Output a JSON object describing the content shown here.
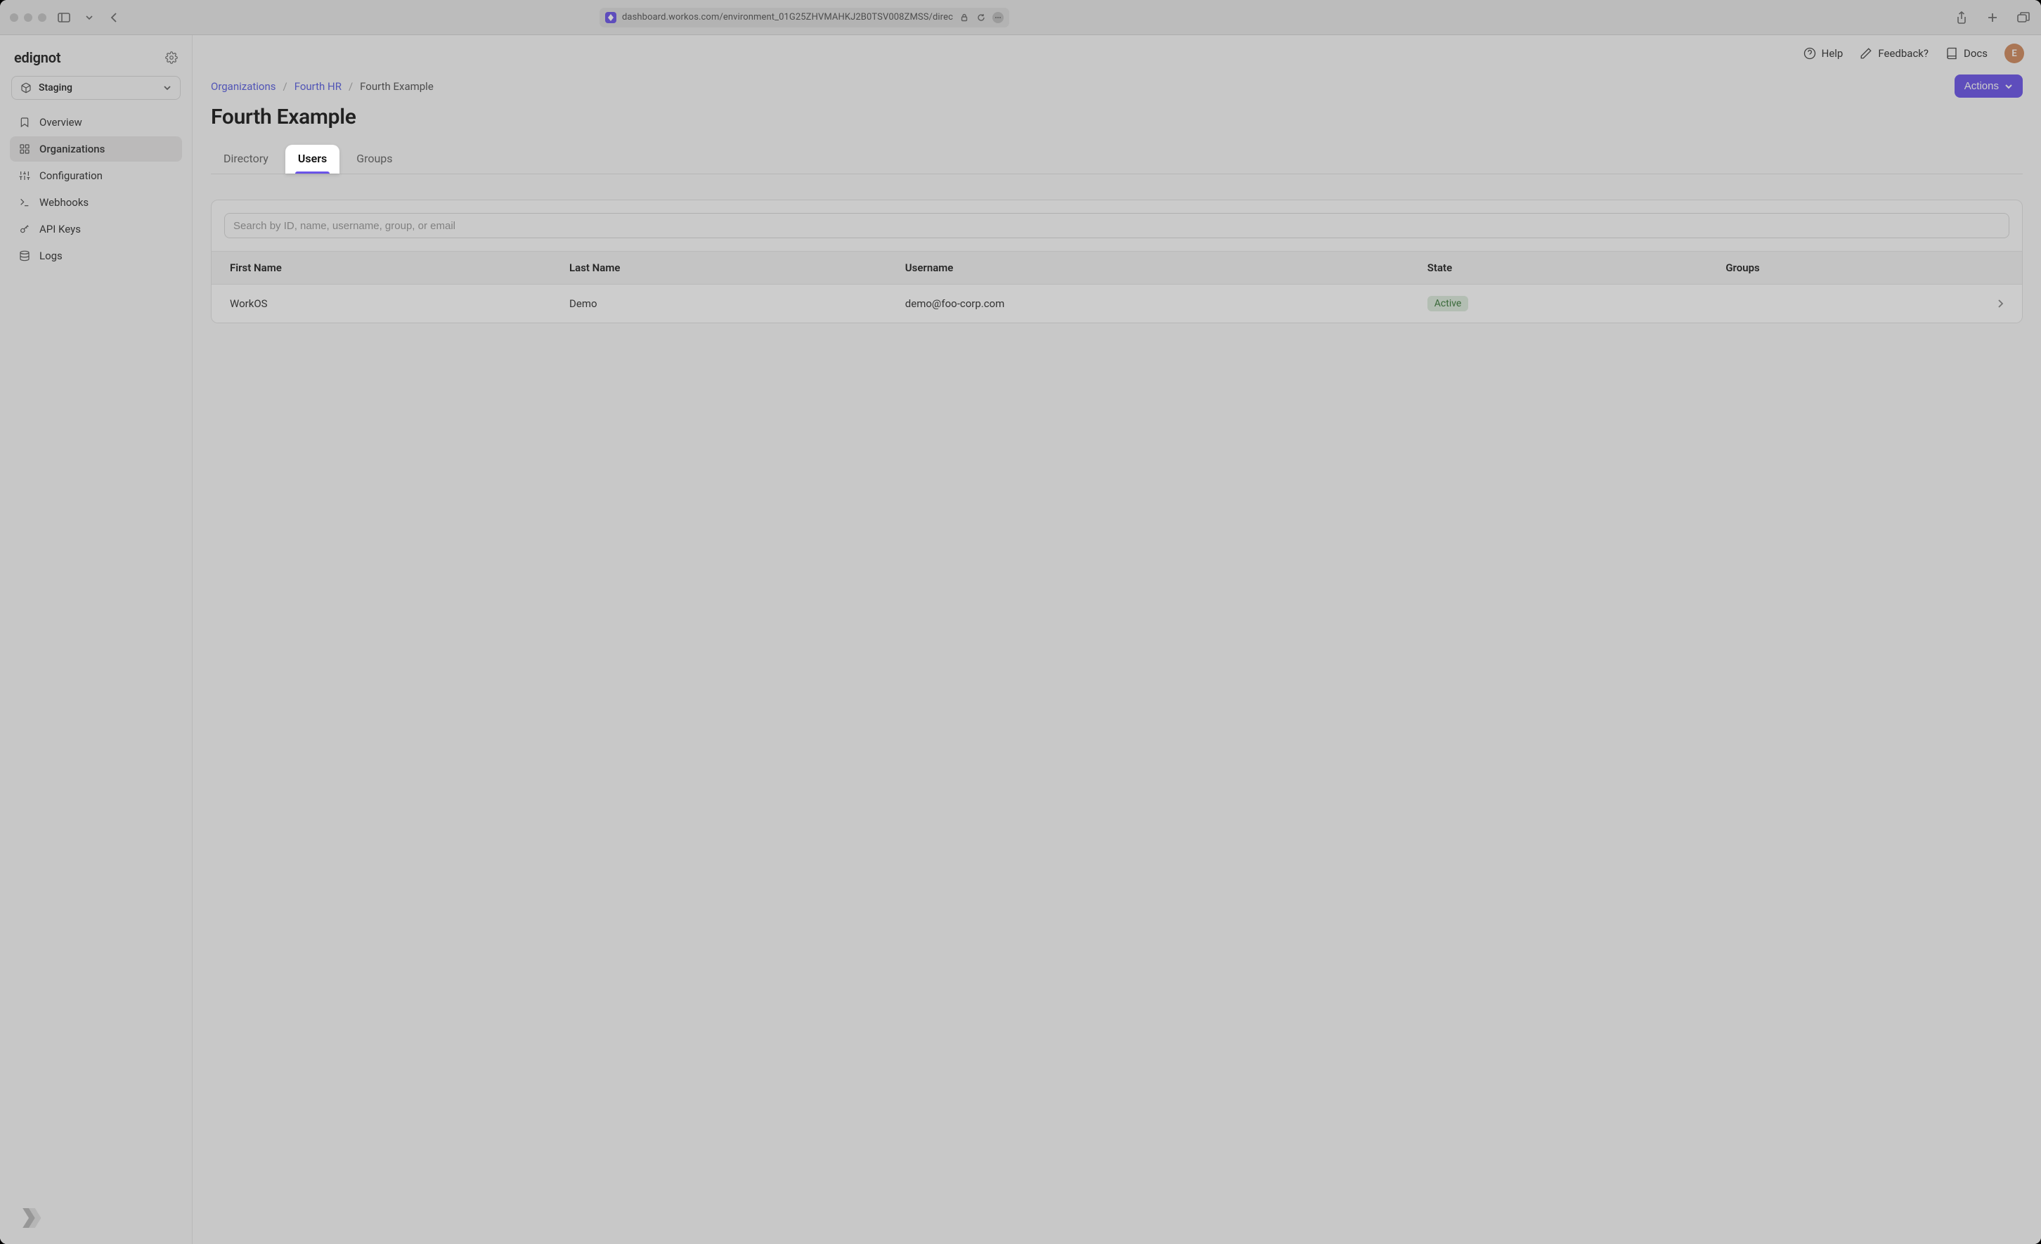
{
  "browser": {
    "url": "dashboard.workos.com/environment_01G25ZHVMAHKJ2B0TSV008ZMSS/direc"
  },
  "workspace": {
    "name": "edignot"
  },
  "environment": {
    "selected": "Staging"
  },
  "sidebar": {
    "items": [
      {
        "label": "Overview"
      },
      {
        "label": "Organizations"
      },
      {
        "label": "Configuration"
      },
      {
        "label": "Webhooks"
      },
      {
        "label": "API Keys"
      },
      {
        "label": "Logs"
      }
    ]
  },
  "topbar": {
    "help": "Help",
    "feedback": "Feedback?",
    "docs": "Docs",
    "avatar_initial": "E"
  },
  "breadcrumbs": {
    "root": "Organizations",
    "parent": "Fourth HR",
    "current": "Fourth Example"
  },
  "page": {
    "title": "Fourth Example",
    "actions_label": "Actions"
  },
  "tabs": [
    {
      "label": "Directory"
    },
    {
      "label": "Users"
    },
    {
      "label": "Groups"
    }
  ],
  "search": {
    "placeholder": "Search by ID, name, username, group, or email"
  },
  "table": {
    "columns": [
      "First Name",
      "Last Name",
      "Username",
      "State",
      "Groups"
    ],
    "rows": [
      {
        "first_name": "WorkOS",
        "last_name": "Demo",
        "username": "demo@foo-corp.com",
        "state": "Active",
        "groups": ""
      }
    ]
  }
}
